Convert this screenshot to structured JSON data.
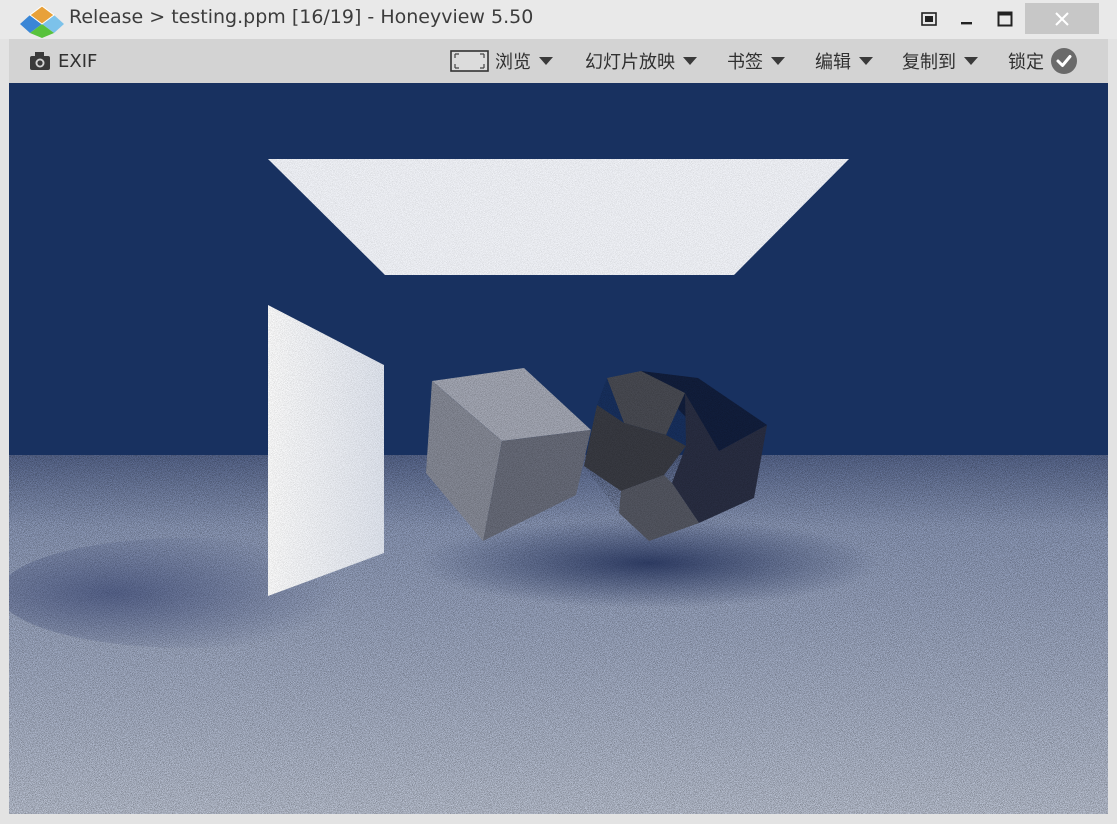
{
  "window": {
    "title": "Release > testing.ppm [16/19] - Honeyview 5.50",
    "controls": {
      "fullscreen_icon": "fullscreen-icon",
      "minimize_icon": "minimize-icon",
      "maximize_icon": "maximize-icon",
      "close_icon": "close-icon"
    }
  },
  "toolbar": {
    "exif_label": "EXIF",
    "browse_label": "浏览",
    "slideshow_label": "幻灯片放映",
    "bookmark_label": "书签",
    "edit_label": "编辑",
    "copy_to_label": "复制到",
    "lock_label": "锁定"
  },
  "colors": {
    "background_wall": "#183160",
    "floor_light": "#b8c2d8",
    "close_button": "#c7c7c7"
  }
}
